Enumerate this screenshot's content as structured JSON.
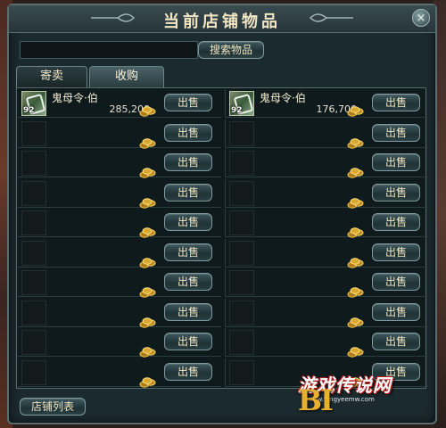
{
  "window": {
    "title": "当前店铺物品",
    "close_glyph": "×"
  },
  "search": {
    "value": "",
    "placeholder": "",
    "button_label": "搜索物品"
  },
  "tabs": [
    {
      "label": "寄卖",
      "active": false
    },
    {
      "label": "收购",
      "active": true
    }
  ],
  "items": [
    {
      "name": "鬼母令·伯",
      "price": "285,200",
      "level": "92",
      "sell_label": "出售"
    },
    {
      "name": "鬼母令·伯",
      "price": "176,700",
      "level": "92",
      "sell_label": "出售"
    },
    {
      "name": "",
      "price": "",
      "level": "",
      "sell_label": "出售"
    },
    {
      "name": "",
      "price": "",
      "level": "",
      "sell_label": "出售"
    },
    {
      "name": "",
      "price": "",
      "level": "",
      "sell_label": "出售"
    },
    {
      "name": "",
      "price": "",
      "level": "",
      "sell_label": "出售"
    },
    {
      "name": "",
      "price": "",
      "level": "",
      "sell_label": "出售"
    },
    {
      "name": "",
      "price": "",
      "level": "",
      "sell_label": "出售"
    },
    {
      "name": "",
      "price": "",
      "level": "",
      "sell_label": "出售"
    },
    {
      "name": "",
      "price": "",
      "level": "",
      "sell_label": "出售"
    },
    {
      "name": "",
      "price": "",
      "level": "",
      "sell_label": "出售"
    },
    {
      "name": "",
      "price": "",
      "level": "",
      "sell_label": "出售"
    },
    {
      "name": "",
      "price": "",
      "level": "",
      "sell_label": "出售"
    },
    {
      "name": "",
      "price": "",
      "level": "",
      "sell_label": "出售"
    },
    {
      "name": "",
      "price": "",
      "level": "",
      "sell_label": "出售"
    },
    {
      "name": "",
      "price": "",
      "level": "",
      "sell_label": "出售"
    },
    {
      "name": "",
      "price": "",
      "level": "",
      "sell_label": "出售"
    },
    {
      "name": "",
      "price": "",
      "level": "",
      "sell_label": "出售"
    },
    {
      "name": "",
      "price": "",
      "level": "",
      "sell_label": "出售"
    },
    {
      "name": "",
      "price": "",
      "level": "",
      "sell_label": "出售"
    }
  ],
  "footer": {
    "store_list_label": "店铺列表"
  },
  "watermark": {
    "text": "游戏传说网",
    "url": "www.9ingyeemw.com",
    "letters": "BI"
  },
  "colors": {
    "panel_bg": "#1b2a2e",
    "frame": "#5a6e72",
    "text_gold": "#f0e6c4",
    "coin_gold": "#d8a830"
  },
  "icons": {
    "coin": "gold-coin-stack-icon",
    "item": "token-icon",
    "close": "close-icon"
  }
}
